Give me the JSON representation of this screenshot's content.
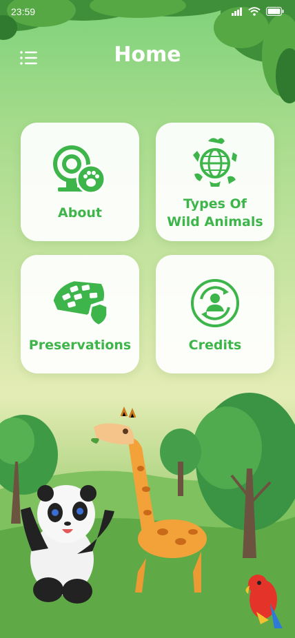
{
  "status_bar": {
    "time": "23:59"
  },
  "header": {
    "title": "Home",
    "menu_icon": "hamburger-menu-icon"
  },
  "cards": [
    {
      "label": "About",
      "icon": "webcam-paw-icon"
    },
    {
      "label": "Types Of\nWild Animals",
      "icon": "globe-animals-icon"
    },
    {
      "label": "Preservations",
      "icon": "shield-map-icon"
    },
    {
      "label": "Credits",
      "icon": "person-refresh-icon"
    }
  ],
  "colors": {
    "accent": "#3db54a",
    "card_bg": "#ffffff",
    "title": "#ffffff"
  }
}
